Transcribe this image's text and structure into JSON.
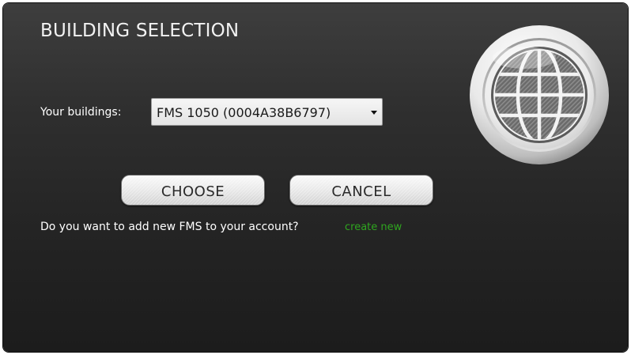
{
  "dialog": {
    "title": "BUILDING SELECTION",
    "buildings_label": "Your buildings:",
    "buildings_select": {
      "selected": "FMS 1050 (0004A38B6797)"
    },
    "choose_label": "CHOOSE",
    "cancel_label": "CANCEL",
    "add_question": "Do you want to add new FMS to your account?",
    "create_new_label": "create new"
  },
  "icons": {
    "globe": "globe-icon",
    "select_caret": "chevron-down-icon"
  },
  "colors": {
    "background": "#2a2a2a",
    "link": "#2fa51f",
    "title_text": "#f2f2f2"
  }
}
